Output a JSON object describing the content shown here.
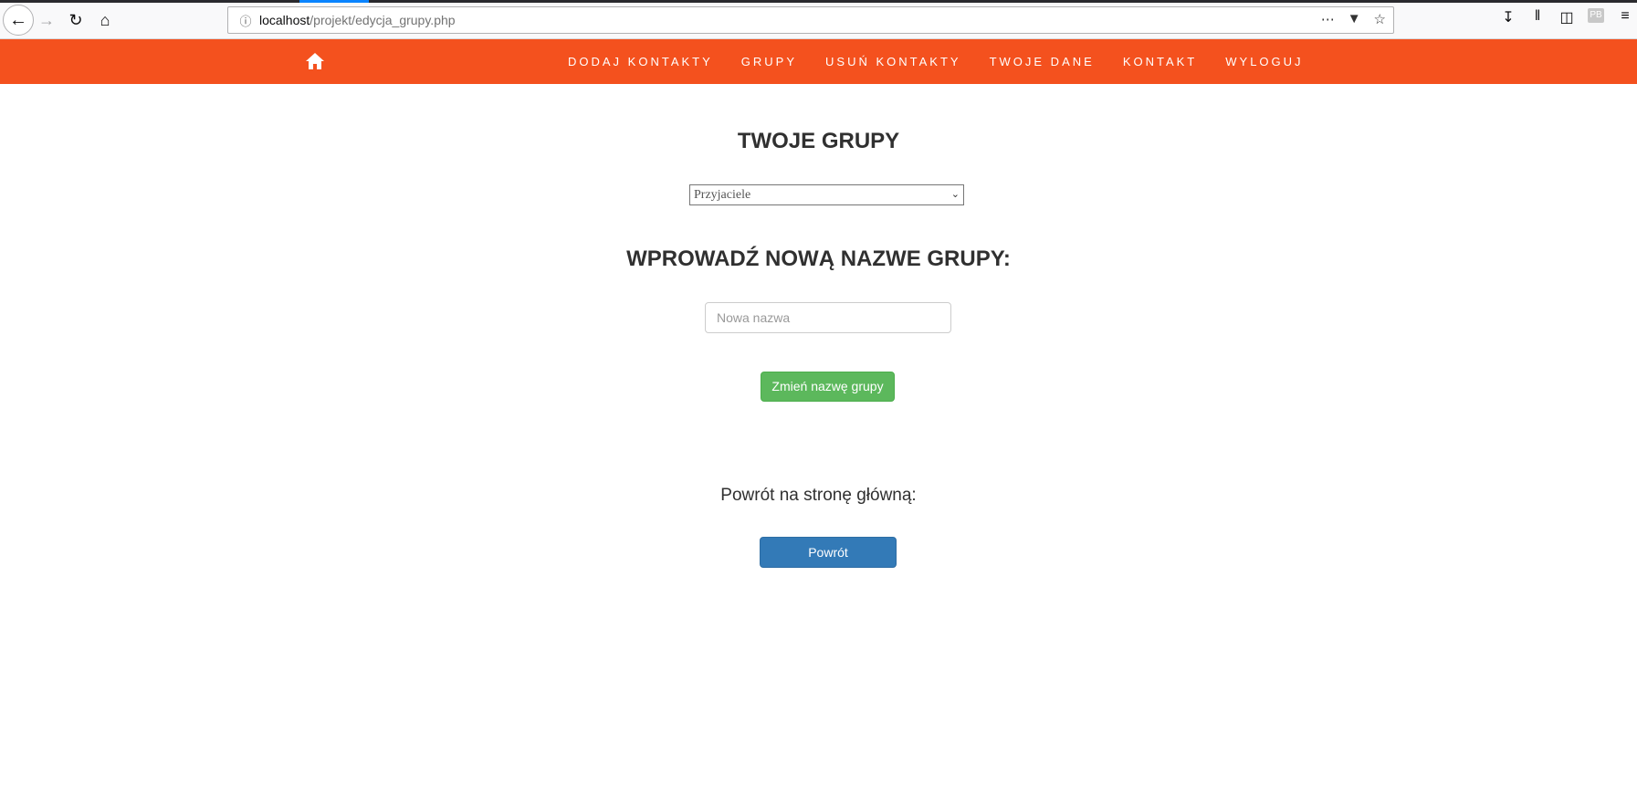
{
  "browser": {
    "url_host": "localhost",
    "url_path": "/projekt/edycja_grupy.php",
    "icons": [
      "back-icon",
      "forward-icon",
      "reload-icon",
      "home-icon",
      "info-icon",
      "more-icon",
      "pocket-icon",
      "bookmark-star-icon",
      "download-icon",
      "library-icon",
      "sidebar-icon",
      "pb-extension-icon",
      "menu-icon"
    ],
    "pb_label": "PB"
  },
  "nav": {
    "accent": "#f4511e",
    "links": [
      "DODAJ KONTAKTY",
      "GRUPY",
      "USUŃ KONTAKTY",
      "TWOJE DANE",
      "KONTAKT",
      "WYLOGUJ"
    ]
  },
  "main": {
    "title": "TWOJE GRUPY",
    "select_value": "Przyjaciele",
    "subtitle": "WPROWADŹ NOWĄ NAZWE GRUPY:",
    "input_placeholder": "Nowa nazwa",
    "rename_button": "Zmień nazwę grupy",
    "back_label": "Powrót na stronę główną:",
    "back_button": "Powrót"
  }
}
